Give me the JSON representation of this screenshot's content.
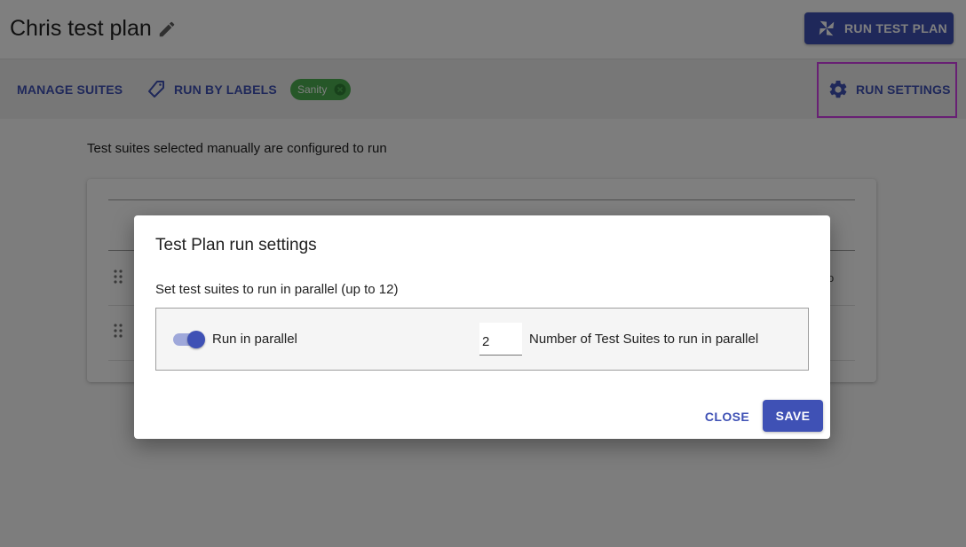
{
  "header": {
    "title": "Chris test plan",
    "edit_icon": "pencil-icon",
    "run_test_plan_label": "RUN TEST PLAN",
    "run_test_plan_icon": "pinwheel-icon"
  },
  "toolbar": {
    "manage_suites_label": "MANAGE SUITES",
    "run_by_labels_label": "RUN BY LABELS",
    "run_by_labels_icon": "label-tag-icon",
    "chip_label": "Sanity",
    "chip_remove_icon": "cancel-circle-icon",
    "run_settings_label": "RUN SETTINGS",
    "run_settings_icon": "gear-icon"
  },
  "main": {
    "description": "Test suites selected manually are configured to run",
    "row_tail_text": "o",
    "drag_icon": "drag-handle-icon"
  },
  "dialog": {
    "title": "Test Plan run settings",
    "subtitle": "Set test suites to run in parallel (up to 12)",
    "toggle_label": "Run in parallel",
    "toggle_on": true,
    "parallel_count": "2",
    "count_label": "Number of Test Suites to run in parallel",
    "close_label": "CLOSE",
    "save_label": "SAVE"
  },
  "colors": {
    "primary": "#3f51b5",
    "chip": "#4caf50",
    "highlight": "#d040e8"
  }
}
